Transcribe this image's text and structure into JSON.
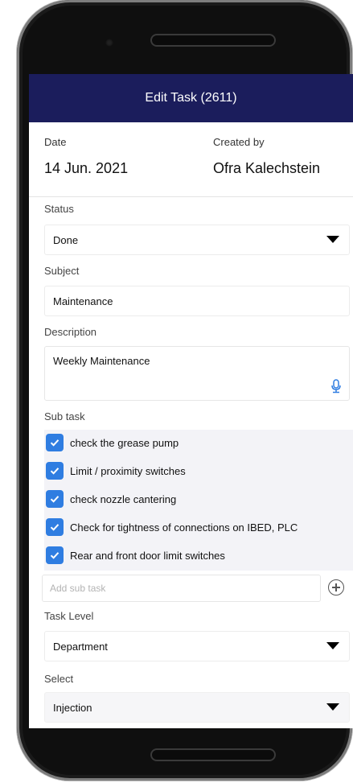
{
  "header": {
    "title": "Edit Task (2611)"
  },
  "info": {
    "date_label": "Date",
    "date_value": "14 Jun. 2021",
    "created_label": "Created by",
    "created_value": "Ofra Kalechstein"
  },
  "status": {
    "label": "Status",
    "value": "Done"
  },
  "subject": {
    "label": "Subject",
    "value": "Maintenance"
  },
  "description": {
    "label": "Description",
    "value": "Weekly Maintenance"
  },
  "subtasks": {
    "label": "Sub task",
    "items": [
      {
        "text": "check the grease pump",
        "checked": true
      },
      {
        "text": "Limit / proximity switches",
        "checked": true
      },
      {
        "text": "check nozzle cantering",
        "checked": true
      },
      {
        "text": "Check for tightness of connections on IBED, PLC",
        "checked": true
      },
      {
        "text": "Rear and front door  limit switches",
        "checked": true
      }
    ],
    "add_placeholder": "Add sub task"
  },
  "task_level": {
    "label": "Task Level",
    "value": "Department"
  },
  "select": {
    "label": "Select",
    "value": "Injection"
  },
  "colors": {
    "header_bg": "#1b1d5c",
    "checkbox": "#2f7de1",
    "mic": "#2f7de1"
  },
  "icons": {
    "dropdown": "caret-down-icon",
    "mic": "microphone-icon",
    "add": "plus-circle-icon",
    "check": "checkmark-icon"
  }
}
